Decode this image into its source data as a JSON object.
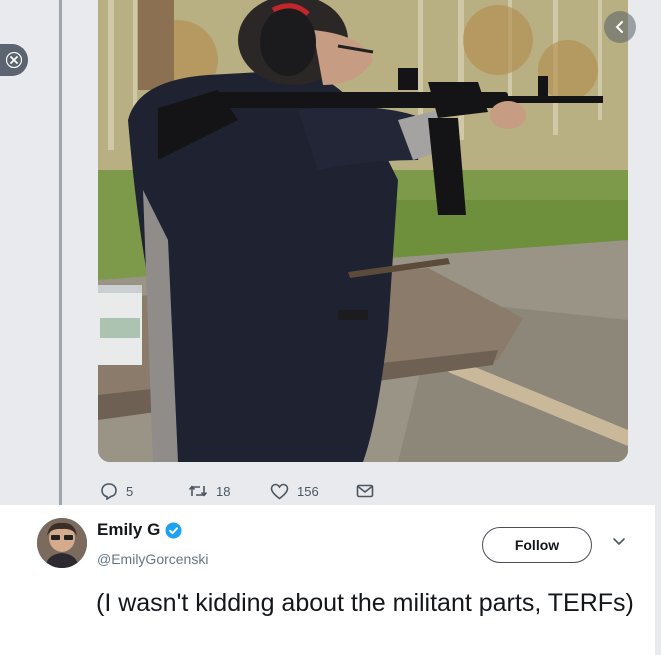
{
  "media_actions": {
    "replies": "5",
    "retweets": "18",
    "likes": "156"
  },
  "tweet": {
    "name": "Emily G",
    "handle": "@EmilyGorcenski",
    "follow_label": "Follow",
    "text": "(I wasn't kidding about the militant parts, TERFs)"
  },
  "icons": {
    "close": "close-icon",
    "nav": "chevron-left-icon",
    "reply": "reply-icon",
    "retweet": "retweet-icon",
    "like": "heart-icon",
    "message": "envelope-icon",
    "verified": "verified-badge-icon",
    "more": "chevron-down-icon"
  },
  "colors": {
    "panel_bg": "#e9eaed",
    "verified_blue": "#1da1f2",
    "text_dark": "#14171a",
    "text_muted": "#657786"
  }
}
